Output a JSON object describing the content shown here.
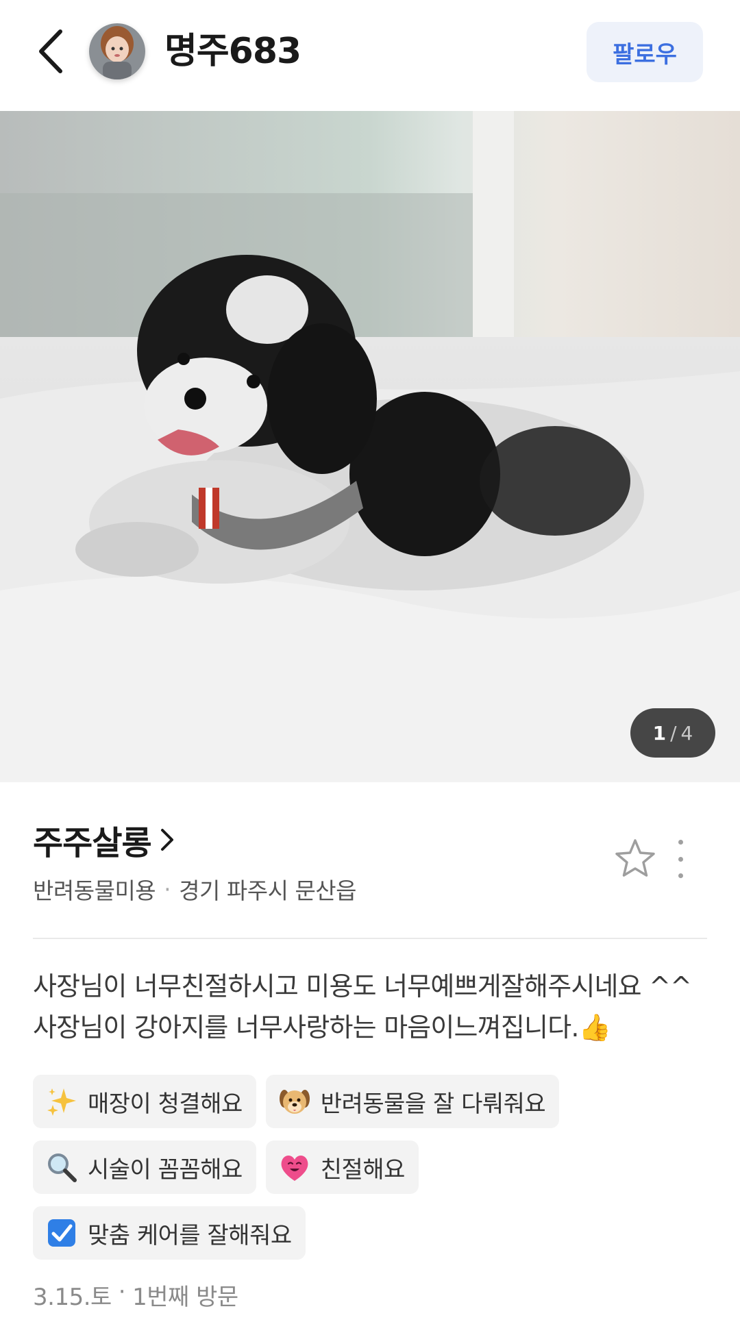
{
  "header": {
    "username": "명주683",
    "follow_label": "팔로우"
  },
  "photo": {
    "current": "1",
    "separator": "/",
    "total": "4"
  },
  "shop": {
    "name": "주주살롱",
    "category": "반려동물미용",
    "separator": "·",
    "location": "경기 파주시 문산읍"
  },
  "review": {
    "text": "사장님이 너무친절하시고 미용도 너무예쁘게잘해주시네요 ^^ 사장님이 강아지를 너무사랑하는 마음이느껴집니다.👍"
  },
  "tags": [
    {
      "icon": "sparkles-icon",
      "label": "매장이 청결해요"
    },
    {
      "icon": "dog-face-icon",
      "label": "반려동물을 잘 다뤄줘요"
    },
    {
      "icon": "magnifier-icon",
      "label": "시술이 꼼꼼해요"
    },
    {
      "icon": "heart-face-icon",
      "label": "친절해요"
    },
    {
      "icon": "check-box-icon",
      "label": "맞춤 케어를 잘해줘요"
    }
  ],
  "visit": {
    "date": "3.15.토",
    "separator": "·",
    "count": "1번째 방문"
  },
  "colors": {
    "accent": "#3c6fe0",
    "follow_bg": "#eef2fa",
    "tag_bg": "#f3f3f3"
  }
}
